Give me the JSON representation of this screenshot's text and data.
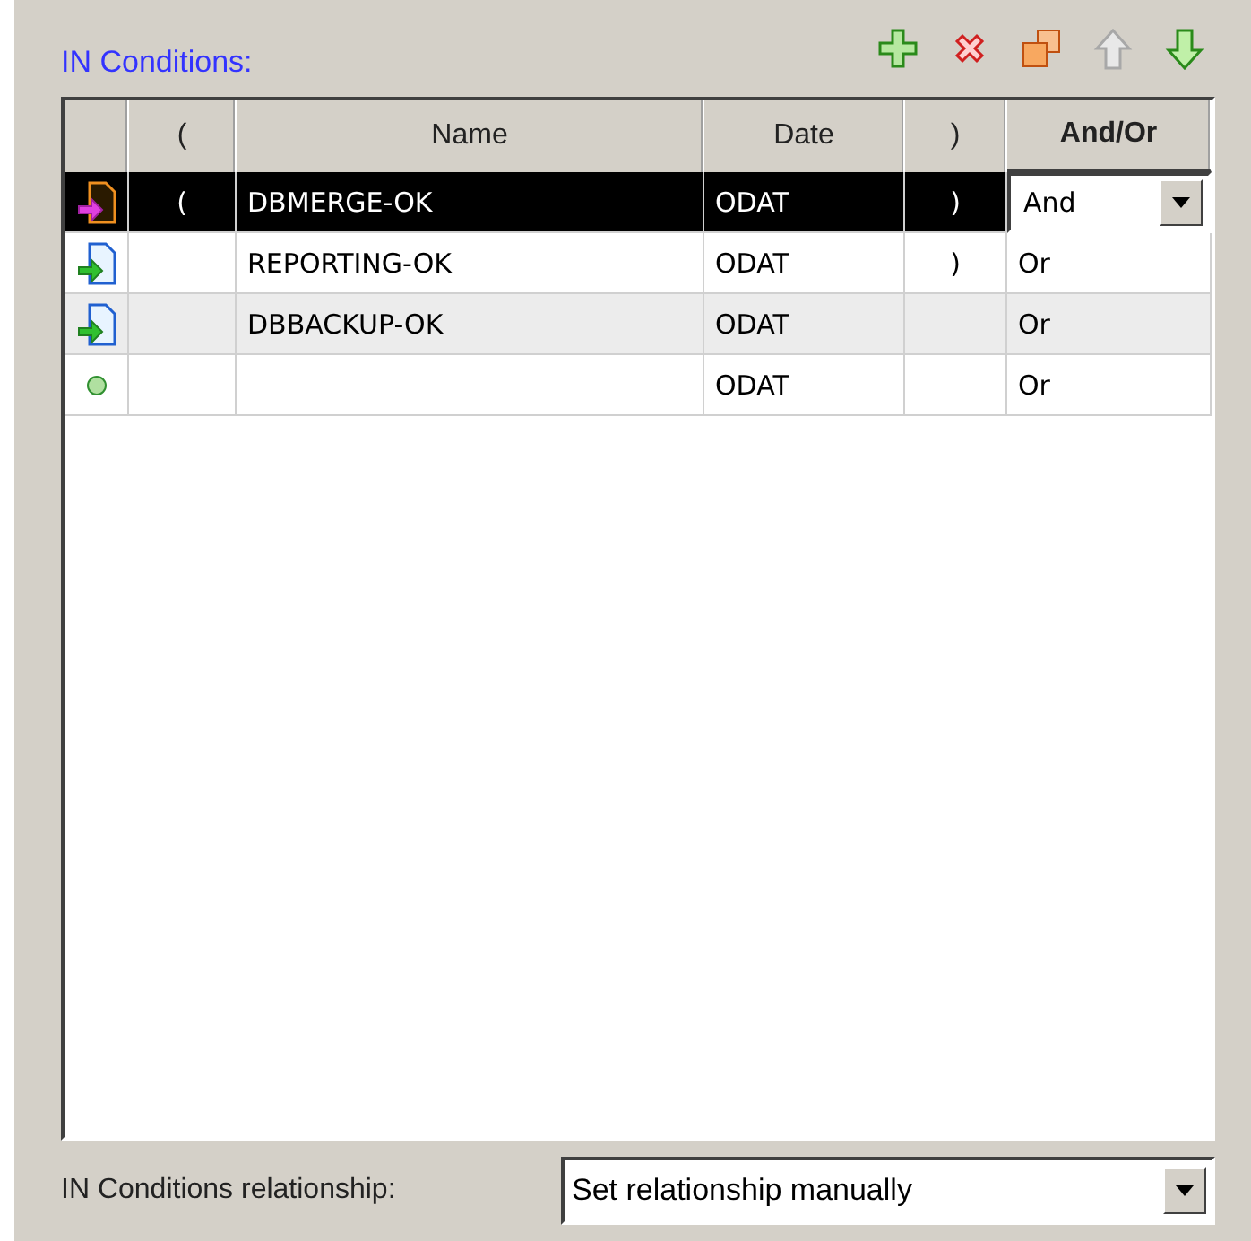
{
  "section": {
    "title": "IN Conditions:"
  },
  "toolbar": [
    {
      "kind": "add"
    },
    {
      "kind": "delete"
    },
    {
      "kind": "copy"
    },
    {
      "kind": "up",
      "disabled": true
    },
    {
      "kind": "down",
      "disabled": false
    }
  ],
  "table": {
    "columns": [
      "(",
      "Name",
      "Date",
      ")",
      "And/Or"
    ],
    "rows": [
      {
        "kind": "document",
        "selected": true,
        "open": "(",
        "name": "DBMERGE-OK",
        "date": "ODAT",
        "close": ")",
        "and_or": "And"
      },
      {
        "kind": "document",
        "selected": false,
        "open": "",
        "name": "REPORTING-OK",
        "date": "ODAT",
        "close": ")",
        "and_or": "Or"
      },
      {
        "kind": "document",
        "selected": false,
        "open": "",
        "name": "DBBACKUP-OK",
        "date": "ODAT",
        "close": "",
        "and_or": "Or"
      },
      {
        "kind": "circle",
        "selected": false,
        "open": "",
        "name": "",
        "date": "ODAT",
        "close": "",
        "and_or": "Or"
      }
    ]
  },
  "relationship": {
    "label": "IN Conditions relationship:",
    "value": "Set relationship manually"
  }
}
